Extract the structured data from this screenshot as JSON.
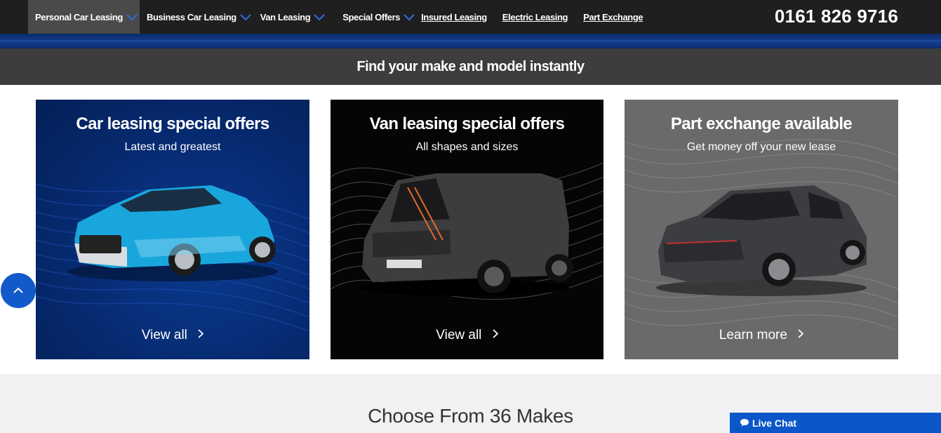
{
  "nav": {
    "dropdowns": [
      {
        "label": "Personal Car Leasing",
        "active": true
      },
      {
        "label": "Business Car Leasing",
        "active": false
      },
      {
        "label": "Van Leasing",
        "active": false
      },
      {
        "label": "Special Offers",
        "active": false
      }
    ],
    "links": [
      "Insured Leasing",
      "Electric Leasing",
      "Part Exchange"
    ],
    "phone": "0161 826 9716"
  },
  "search_bar": {
    "label": "Find your make and model instantly"
  },
  "cards": [
    {
      "title": "Car leasing special offers",
      "subtitle": "Latest and greatest",
      "cta": "View all",
      "vehicle": "car-image"
    },
    {
      "title": "Van leasing special offers",
      "subtitle": "All shapes and sizes",
      "cta": "View all",
      "vehicle": "van-image"
    },
    {
      "title": "Part exchange available",
      "subtitle": "Get money off your new lease",
      "cta": "Learn more",
      "vehicle": "hatchback-image"
    }
  ],
  "makes": {
    "title": "Choose From 36 Makes"
  },
  "live_chat": {
    "label": "Live Chat",
    "icon": "chat-bubble-icon"
  },
  "scroll_top": {
    "icon": "chevron-up-icon"
  },
  "colors": {
    "accent": "#0b57c9",
    "nav_bg": "#1f1f20",
    "active_nav_bg": "#4a4a4b",
    "search_bg": "#3d3d3d",
    "card_blue": "#062a70",
    "card_black": "#050505",
    "card_grey": "#6a6a6a"
  }
}
